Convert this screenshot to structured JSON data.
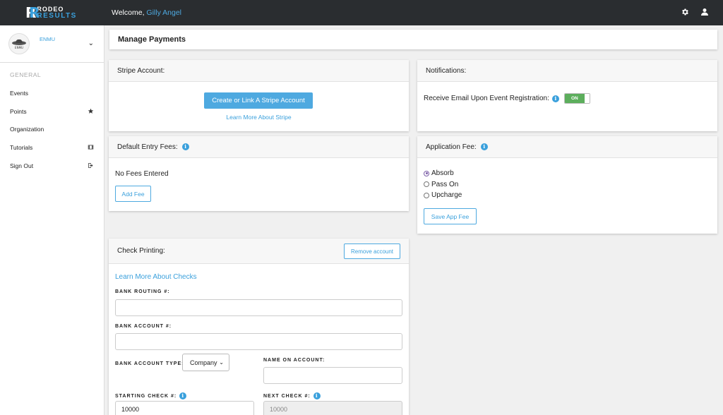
{
  "app": {
    "logo_line1": "RODEO",
    "logo_line2": "RESULTS",
    "welcome_prefix": "Welcome, ",
    "username": "Gilly Angel",
    "icons": [
      "settings-gear-icon",
      "user-icon"
    ]
  },
  "sidebar": {
    "org_name": "ENMU",
    "org_badge": "ENMU",
    "heading": "GENERAL",
    "items": [
      {
        "label": "Events",
        "icon": ""
      },
      {
        "label": "Points",
        "icon": "star-icon"
      },
      {
        "label": "Organization",
        "icon": ""
      },
      {
        "label": "Tutorials",
        "icon": "film-icon"
      },
      {
        "label": "Sign Out",
        "icon": "sign-out-icon"
      }
    ]
  },
  "page": {
    "title": "Manage Payments"
  },
  "stripe": {
    "header": "Stripe Account:",
    "button": "Create or Link A Stripe Account",
    "link": "Learn More About Stripe"
  },
  "notifications": {
    "header": "Notifications:",
    "label": "Receive Email Upon Event Registration:",
    "toggle": "ON"
  },
  "entry_fees": {
    "header": "Default Entry Fees:",
    "empty": "No Fees Entered",
    "button": "Add Fee"
  },
  "app_fee": {
    "header": "Application Fee:",
    "options": [
      "Absorb",
      "Pass On",
      "Upcharge"
    ],
    "selected": "Absorb",
    "button": "Save App Fee"
  },
  "checks": {
    "header": "Check Printing:",
    "remove_button": "Remove account",
    "link": "Learn More About Checks",
    "routing_label": "BANK ROUTING #:",
    "routing_value": "",
    "account_label": "BANK ACCOUNT #:",
    "account_value": "",
    "type_label": "BANK ACCOUNT TYPE:",
    "type_value": "Company",
    "name_label": "NAME ON ACCOUNT:",
    "name_value": "",
    "start_label": "STARTING CHECK #:",
    "start_value": "10000",
    "next_label": "NEXT CHECK #:",
    "next_value": "10000"
  },
  "colors": {
    "accent": "#3aa0dc",
    "topbar": "#2a2d30",
    "toggle_on": "#5cae5c",
    "radio_checked": "#7b5ea7"
  }
}
